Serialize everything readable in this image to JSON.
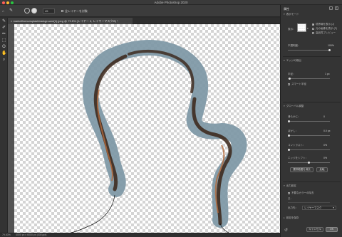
{
  "window": {
    "title": "Adobe Photoshop 2020"
  },
  "options_bar": {
    "size_value": "45",
    "sample_label": "全レイヤーを対象"
  },
  "tab": {
    "label": "markelfromunsplashbackground(1).jpeg @ 79.5% (レイヤー 0, レイヤーマスク/8) *"
  },
  "status": {
    "zoom": "79.53%",
    "doc_info": "4000 px x 6000 px (300 ppi)"
  },
  "panel": {
    "title": "属性",
    "view_mode": {
      "section": "表示モード",
      "label": "表示：",
      "show_edge": "境界線を表示 (J)",
      "show_original": "元の画像を表示 (P)",
      "hq_preview": "高品質プレビュー",
      "opacity_label": "不透明度：",
      "opacity_value": "100%"
    },
    "edge_detection": {
      "section": "エッジの検出",
      "radius_label": "半径：",
      "radius_value": "1 px",
      "smart_radius": "スマート半径"
    },
    "global": {
      "section": "グローバル調整",
      "smooth_label": "滑らかに：",
      "smooth_value": "0",
      "feather_label": "ぼかし：",
      "feather_value": "0.0 px",
      "contrast_label": "コントラスト：",
      "contrast_value": "0%",
      "shift_label": "エッジをシフト：",
      "shift_value": "0%",
      "clear_button": "選択範囲を消去",
      "invert_button": "反転"
    },
    "output": {
      "section": "出力設定",
      "decontam": "不要なカラーの除去",
      "amount_label": "量：",
      "output_to_label": "出力先：",
      "output_to_value": "レイヤーマスク",
      "remember": "設定を保存"
    },
    "buttons": {
      "cancel": "キャンセル",
      "ok": "OK"
    }
  },
  "colors": {
    "overlay": "#7d97a5",
    "hair_dark": "#3a2418",
    "hair_light": "#b4693a"
  }
}
